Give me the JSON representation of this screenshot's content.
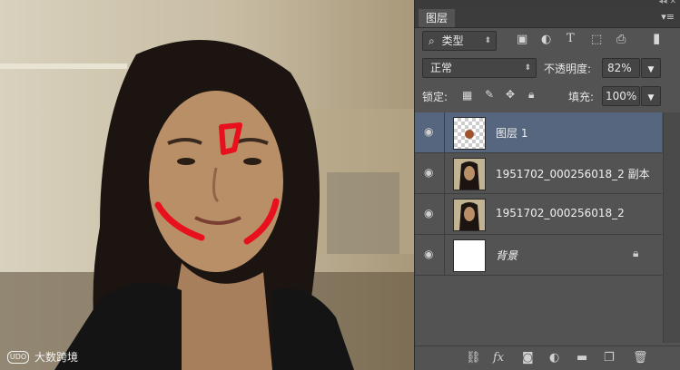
{
  "panel": {
    "tab_label": "图层",
    "menu_icon": "panel-menu-icon",
    "filter": {
      "kind_label": "类型"
    },
    "blend_mode": "正常",
    "opacity_label": "不透明度:",
    "opacity_value": "82%",
    "lock_label": "锁定:",
    "fill_label": "填充:",
    "fill_value": "100%",
    "layers": [
      {
        "name": "图层 1",
        "selected": true
      },
      {
        "name": "1951702_000256018_2 副本",
        "selected": false
      },
      {
        "name": "1951702_000256018_2",
        "selected": false
      },
      {
        "name": "背景",
        "selected": false,
        "locked": true
      }
    ],
    "footer_icons": [
      "link-icon",
      "fx-icon",
      "mask-icon",
      "adjustment-icon",
      "folder-icon",
      "new-layer-icon",
      "trash-icon"
    ]
  },
  "watermark": {
    "text": "大数跨境",
    "logo": "⁠UDO"
  },
  "colors": {
    "panel_bg": "#535353",
    "selected_row": "#55667e",
    "annotation": "#e8101c"
  }
}
